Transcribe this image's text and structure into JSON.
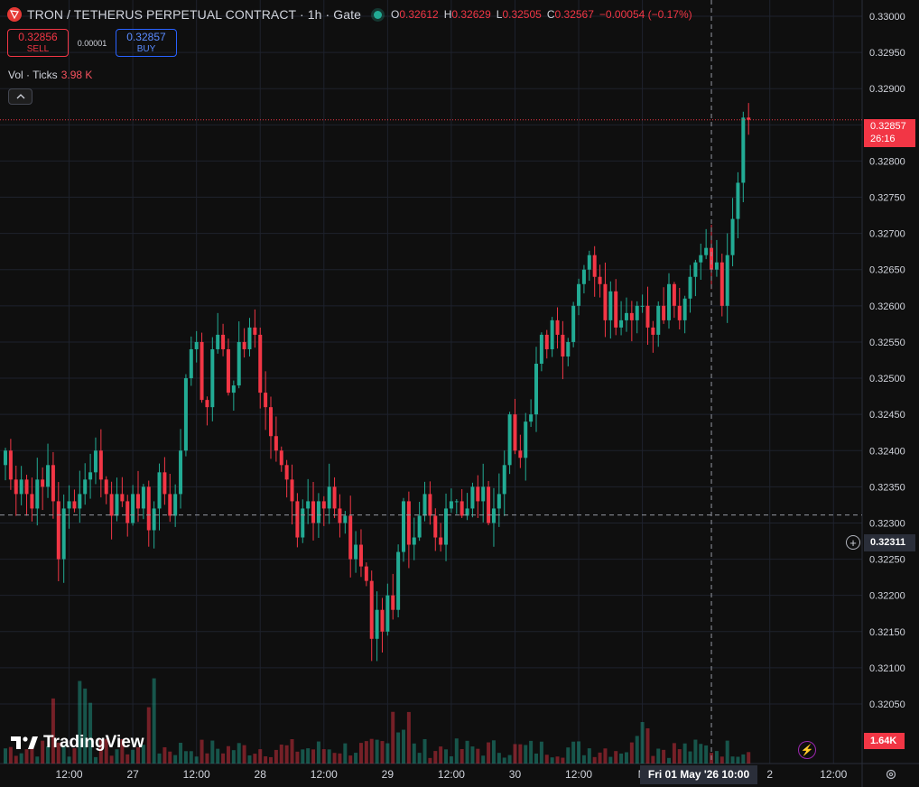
{
  "header": {
    "title": "TRON / TETHERUS PERPETUAL CONTRACT · 1h · Gate",
    "ohlc": [
      {
        "k": "O",
        "v": "0.32612"
      },
      {
        "k": "H",
        "v": "0.32629"
      },
      {
        "k": "L",
        "v": "0.32505"
      },
      {
        "k": "C",
        "v": "0.32567"
      }
    ],
    "change": "−0.00054 (−0.17%)"
  },
  "trade": {
    "sell_price": "0.32856",
    "sell_label": "SELL",
    "spread": "0.00001",
    "buy_price": "0.32857",
    "buy_label": "BUY"
  },
  "volume_legend": {
    "label": "Vol · Ticks",
    "value": "3.98 K"
  },
  "collapse_icon": "chevron-up-icon",
  "watermark": {
    "text": "TradingView",
    "icon": "tradingview-logo-icon"
  },
  "price_tag": {
    "price": "0.32857",
    "countdown": "26:16",
    "color": "#f23645"
  },
  "crosshair": {
    "price": "0.32311",
    "time": "Fri 01 May '26  10:00",
    "x_index": 133
  },
  "volume_tag": "1.64K",
  "colors": {
    "up": "#22ab94",
    "down": "#f23645",
    "bg": "#0f0f0f",
    "grid": "#1e222d"
  },
  "chart_data": {
    "type": "candlestick",
    "interval": "1h",
    "y_ticks": [
      "0.33000",
      "0.32950",
      "0.32900",
      "0.32850",
      "0.32800",
      "0.32750",
      "0.32700",
      "0.32650",
      "0.32600",
      "0.32550",
      "0.32500",
      "0.32450",
      "0.32400",
      "0.32350",
      "0.32300",
      "0.32250",
      "0.32200",
      "0.32150",
      "0.32100",
      "0.32050"
    ],
    "ylim": [
      0.3202,
      0.33025
    ],
    "x_ticks": [
      {
        "label": "12:00",
        "index": 12
      },
      {
        "label": "27",
        "index": 24
      },
      {
        "label": "12:00",
        "index": 36
      },
      {
        "label": "28",
        "index": 48
      },
      {
        "label": "12:00",
        "index": 60
      },
      {
        "label": "29",
        "index": 72
      },
      {
        "label": "12:00",
        "index": 84
      },
      {
        "label": "30",
        "index": 96
      },
      {
        "label": "12:00",
        "index": 108
      },
      {
        "label": "M",
        "index": 120
      },
      {
        "label": "2",
        "index": 144
      },
      {
        "label": "12:00",
        "index": 156
      }
    ],
    "closes": [
      0.324,
      0.3236,
      0.3234,
      0.3236,
      0.3234,
      0.3232,
      0.3236,
      0.3235,
      0.3238,
      0.3233,
      0.3225,
      0.3232,
      0.3233,
      0.3232,
      0.3234,
      0.3236,
      0.3237,
      0.324,
      0.3236,
      0.3234,
      0.3231,
      0.3234,
      0.3233,
      0.323,
      0.3234,
      0.3232,
      0.3235,
      0.3229,
      0.3232,
      0.3237,
      0.3234,
      0.3231,
      0.3234,
      0.324,
      0.325,
      0.3254,
      0.3255,
      0.3247,
      0.3246,
      0.3254,
      0.3256,
      0.3254,
      0.3248,
      0.3249,
      0.3255,
      0.3254,
      0.3257,
      0.3256,
      0.3248,
      0.3246,
      0.3242,
      0.324,
      0.3238,
      0.3236,
      0.3233,
      0.3228,
      0.3232,
      0.3233,
      0.323,
      0.3233,
      0.3232,
      0.3235,
      0.3232,
      0.323,
      0.3231,
      0.3225,
      0.3227,
      0.3224,
      0.3222,
      0.3214,
      0.3218,
      0.3215,
      0.322,
      0.3218,
      0.3226,
      0.3233,
      0.3227,
      0.3228,
      0.3231,
      0.3234,
      0.3231,
      0.3228,
      0.3227,
      0.3232,
      0.3233,
      0.3233,
      0.3231,
      0.3232,
      0.3235,
      0.3233,
      0.3235,
      0.323,
      0.3232,
      0.3234,
      0.3238,
      0.3245,
      0.324,
      0.3239,
      0.3244,
      0.3245,
      0.3252,
      0.3256,
      0.3254,
      0.3258,
      0.3256,
      0.3253,
      0.3255,
      0.326,
      0.3263,
      0.3265,
      0.3267,
      0.3264,
      0.3263,
      0.3258,
      0.3262,
      0.3257,
      0.3258,
      0.3259,
      0.3258,
      0.326,
      0.326,
      0.3257,
      0.3256,
      0.326,
      0.3258,
      0.3263,
      0.326,
      0.3258,
      0.3261,
      0.3264,
      0.3266,
      0.3267,
      0.3268,
      0.3265,
      0.3266,
      0.326,
      0.3267,
      0.3272,
      0.3277,
      0.3286,
      0.32857
    ],
    "highs_above_close": "estimated from image; rendered as wick spans",
    "last_price": 0.32857
  }
}
